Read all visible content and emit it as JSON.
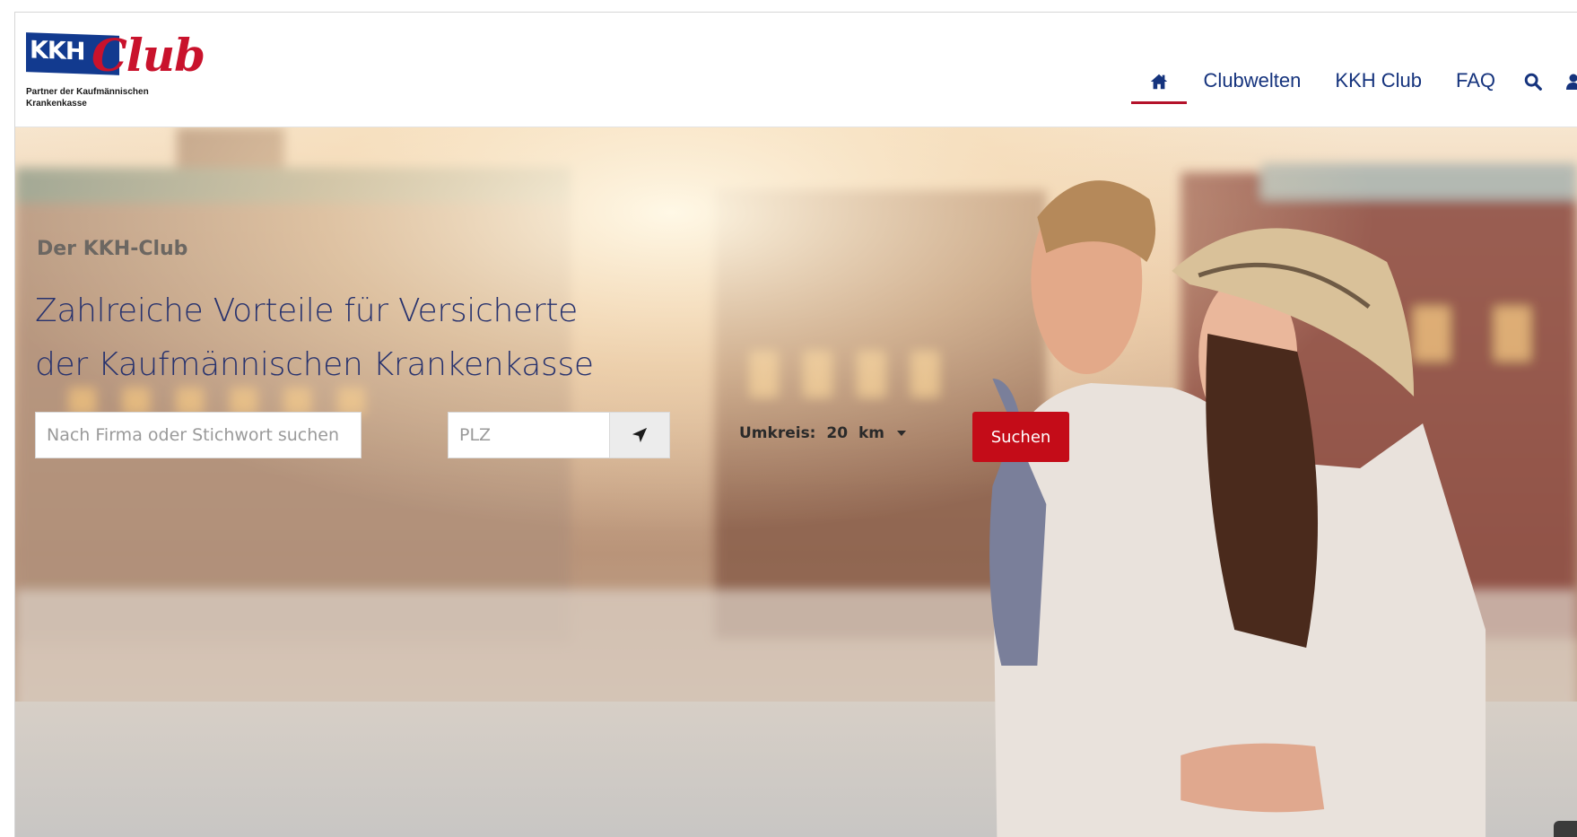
{
  "header": {
    "logo": {
      "brand": "KKH",
      "script": "Club",
      "tagline_line1": "Partner der Kaufmännischen",
      "tagline_line2": "Krankenkasse"
    },
    "nav": {
      "home_icon": "home-icon",
      "items": [
        {
          "label": "Clubwelten"
        },
        {
          "label": "KKH Club"
        },
        {
          "label": "FAQ"
        }
      ],
      "search_icon": "search-icon",
      "user_icon": "user-icon"
    },
    "colors": {
      "nav_text": "#15337d",
      "active_underline": "#b4122a",
      "logo_blue": "#123a8f",
      "logo_red": "#c9122c"
    }
  },
  "hero": {
    "eyebrow": "Der KKH-Club",
    "headline_line1": "Zahlreiche Vorteile für Versicherte",
    "headline_line2": "der Kaufmännischen Krankenkasse",
    "search": {
      "keyword_placeholder": "Nach Firma oder Stichwort suchen",
      "keyword_value": "",
      "plz_placeholder": "PLZ",
      "plz_value": "",
      "locate_icon": "location-arrow-icon",
      "radius_label": "Umkreis:",
      "radius_value": "20",
      "radius_unit": "km",
      "submit_label": "Suchen"
    },
    "colors": {
      "headline": "#27326e",
      "button": "#c40c18"
    }
  }
}
